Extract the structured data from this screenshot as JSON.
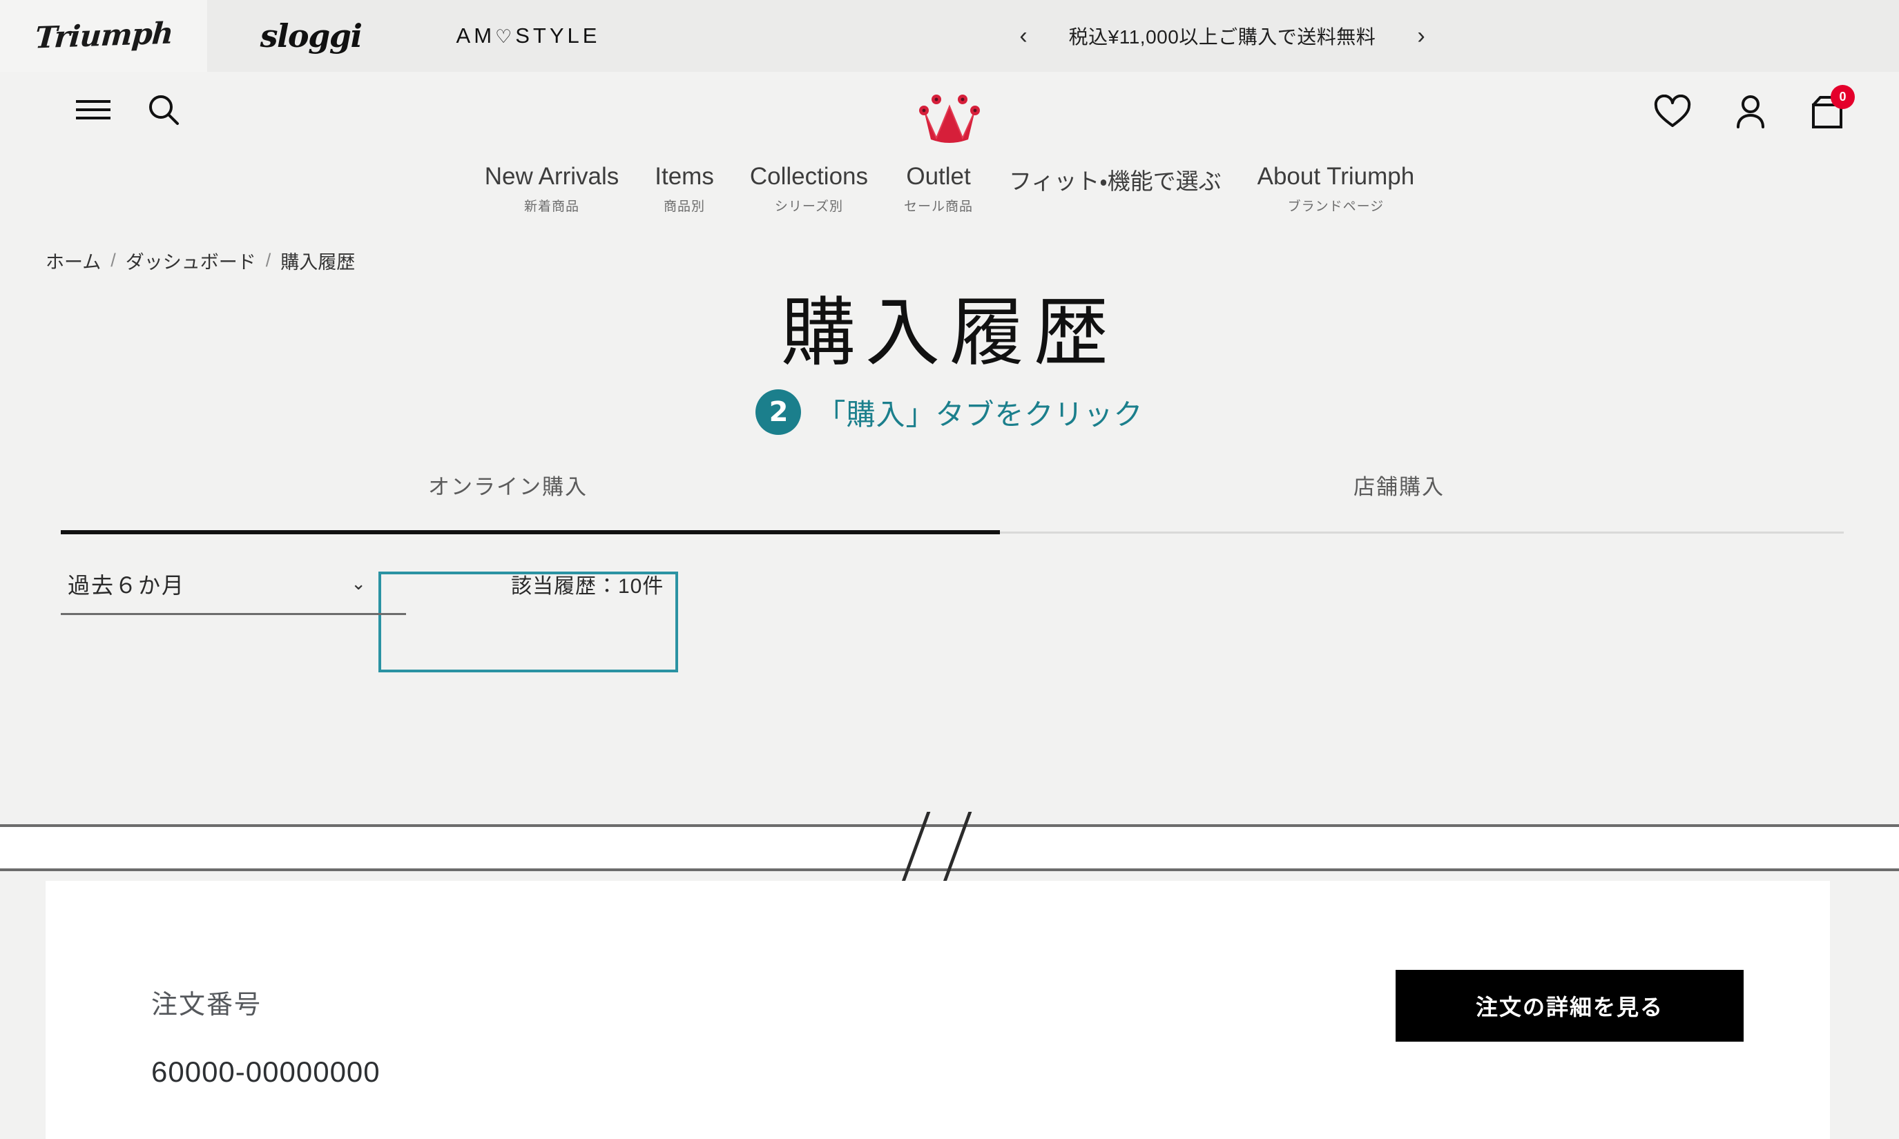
{
  "brandbar": {
    "brands": [
      {
        "name": "Triumph",
        "icon": "triumph-logo"
      },
      {
        "name": "sloggi",
        "icon": "sloggi-logo"
      },
      {
        "name": "AMOSTYLE",
        "icon": "amostyle-logo"
      }
    ],
    "promo": {
      "prev_icon": "chevron-left-icon",
      "text": "税込¥11,000以上ご購入で送料無料",
      "next_icon": "chevron-right-icon"
    }
  },
  "header": {
    "menu_icon": "hamburger-menu-icon",
    "search_icon": "search-icon",
    "logo_icon": "triumph-crown-logo",
    "wishlist_icon": "heart-icon",
    "account_icon": "person-icon",
    "cart_icon": "shopping-bag-icon",
    "cart_count": "0",
    "brand_red": "#e4002b"
  },
  "nav": {
    "items": [
      {
        "en": "New Arrivals",
        "jp": "新着商品"
      },
      {
        "en": "Items",
        "jp": "商品別"
      },
      {
        "en": "Collections",
        "jp": "シリーズ別"
      },
      {
        "en": "Outlet",
        "jp": "セール商品"
      },
      {
        "en": "フィット・機能で選ぶ",
        "jp": ""
      },
      {
        "en": "About Triumph",
        "jp": "ブランドページ"
      }
    ]
  },
  "breadcrumb": {
    "items": [
      "ホーム",
      "ダッシュボード",
      "購入履歴"
    ],
    "separator": "/"
  },
  "page": {
    "title": "購入履歴"
  },
  "annotation": {
    "step_number": "2",
    "text": "「購入」タブをクリック",
    "color": "#1b7f8c"
  },
  "tabs": {
    "online": "オンライン購入",
    "store": "店舗購入",
    "active": "オンライン購入",
    "highlight_color": "#2b93a3"
  },
  "filter": {
    "period_value": "過去６か月",
    "chevron_icon": "chevron-down-icon",
    "count_text": "該当履歴：10件"
  },
  "order_card": {
    "order_no_label": "注文番号",
    "order_no_value": "60000-00000000",
    "detail_button": "注文の詳細を見る"
  }
}
